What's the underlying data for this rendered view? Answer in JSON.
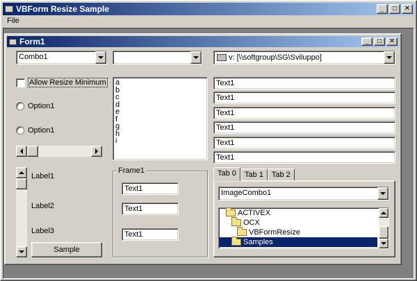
{
  "outer_window": {
    "title": "VBForm Resize Sample",
    "menu": [
      "File"
    ]
  },
  "form": {
    "title": "Form1",
    "combo1": {
      "value": "Combo1"
    },
    "combo2": {
      "value": ""
    },
    "drive_combo": {
      "value": "v: [\\\\softgroup\\SG\\Sviluppo]"
    },
    "checkbox": {
      "label": "Allow Resize Minimum",
      "checked": false
    },
    "option1": {
      "label": "Option1"
    },
    "option2": {
      "label": "Option1"
    },
    "list_items": [
      "a",
      "b",
      "c",
      "d",
      "e",
      "f",
      "g",
      "h",
      "i"
    ],
    "labels": [
      "Label1",
      "Label2",
      "Label3"
    ],
    "sample_button": "Sample",
    "frame": {
      "title": "Frame1",
      "texts": [
        "Text1",
        "Text1",
        "Text1"
      ]
    },
    "right_texts": [
      "Text1",
      "Text1",
      "Text1",
      "Text1",
      "Text1",
      "Text1"
    ],
    "tabs": [
      "Tab 0",
      "Tab 1",
      "Tab 2"
    ],
    "image_combo": {
      "value": "ImageCombo1"
    },
    "tree": [
      {
        "label": "ACTIVEX",
        "selected": false
      },
      {
        "label": "OCX",
        "selected": false
      },
      {
        "label": "VBFormResize",
        "selected": false
      },
      {
        "label": "Samples",
        "selected": true
      }
    ]
  },
  "icons": {
    "title_min": "minimize-icon",
    "title_max": "maximize-icon",
    "title_close": "close-icon",
    "drive": "network-drive-icon",
    "folder": "folder-icon"
  },
  "colors": {
    "title_active": "#0a246a",
    "title_gradient_end": "#a6caf0",
    "face": "#d4d0c8",
    "desktop": "#808080"
  }
}
